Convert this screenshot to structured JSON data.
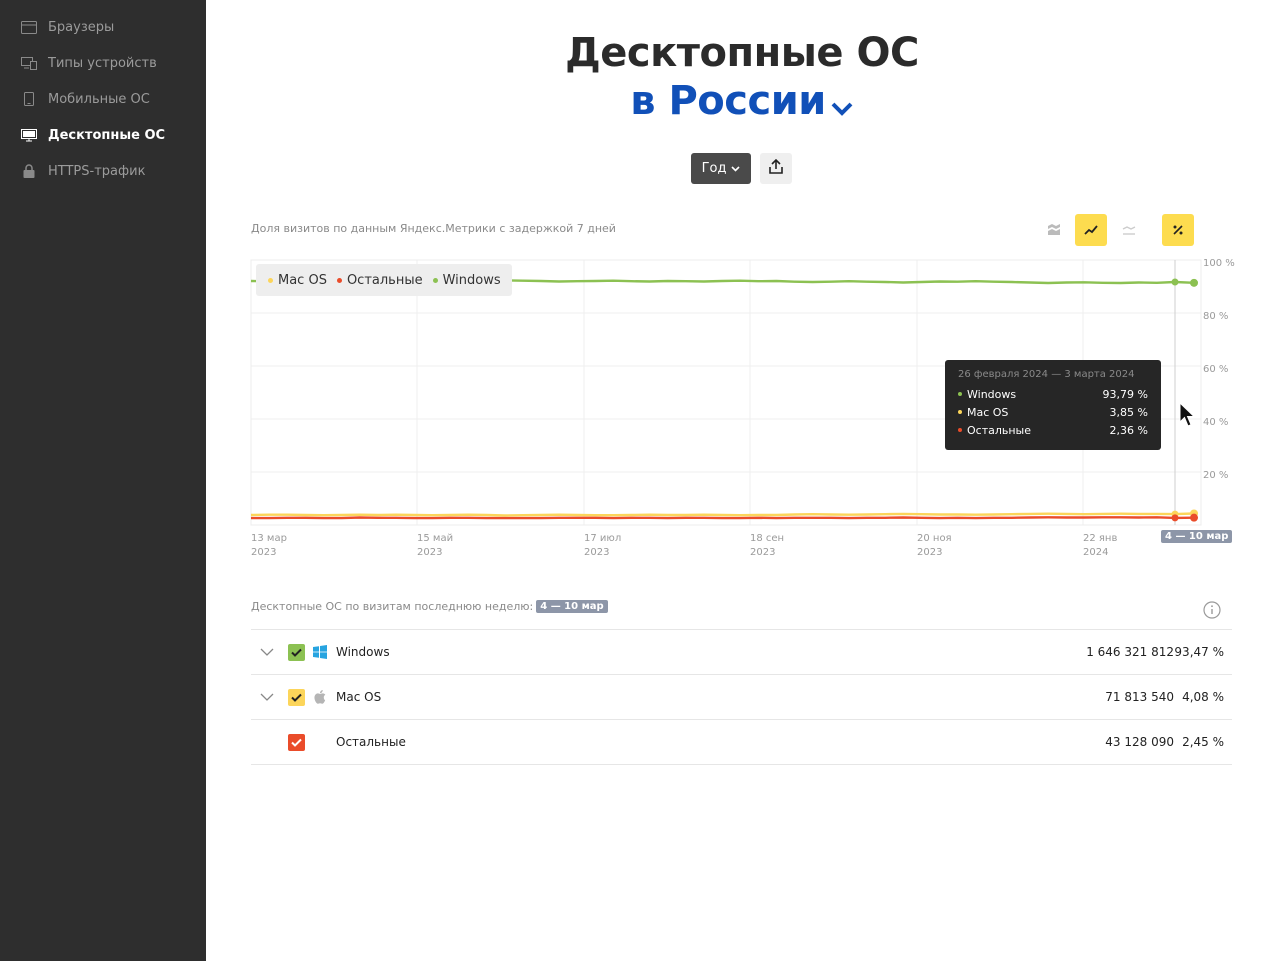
{
  "sidebar": {
    "items": [
      {
        "label": "Браузеры",
        "icon": "browser-window-icon",
        "active": false
      },
      {
        "label": "Типы устройств",
        "icon": "devices-icon",
        "active": false
      },
      {
        "label": "Мобильные ОС",
        "icon": "mobile-phone-icon",
        "active": false
      },
      {
        "label": "Десктопные ОС",
        "icon": "desktop-monitor-icon",
        "active": true
      },
      {
        "label": "HTTPS-трафик",
        "icon": "lock-icon",
        "active": false
      }
    ]
  },
  "header": {
    "title_line1": "Десктопные ОС",
    "title_line2": "в России"
  },
  "controls": {
    "period_label": "Год"
  },
  "chart": {
    "subtitle": "Доля визитов по данным Яндекс.Метрики с задержкой 7 дней",
    "current_week_label": "4 — 10 мар"
  },
  "tooltip": {
    "period": "26 февраля 2024 — 3 марта 2024",
    "rows": [
      {
        "name": "Windows",
        "value": "93,79 %",
        "color": "#8cc152"
      },
      {
        "name": "Mac OS",
        "value": "3,85 %",
        "color": "#fcd55a"
      },
      {
        "name": "Остальные",
        "value": "2,36 %",
        "color": "#ea4c2a"
      }
    ]
  },
  "chart_data": {
    "type": "line",
    "x": [
      "13 мар 2023",
      "15 май 2023",
      "17 июл 2023",
      "18 сен 2023",
      "20 ноя 2023",
      "22 янв 2024",
      "4 — 10 мар"
    ],
    "x_ticks": [
      {
        "day": "13 мар",
        "year": "2023"
      },
      {
        "day": "15 май",
        "year": "2023"
      },
      {
        "day": "17 июл",
        "year": "2023"
      },
      {
        "day": "18 сен",
        "year": "2023"
      },
      {
        "day": "20 ноя",
        "year": "2023"
      },
      {
        "day": "22 янв",
        "year": "2024"
      }
    ],
    "y_ticks": [
      "100 %",
      "80 %",
      "60 %",
      "40 %",
      "20 %"
    ],
    "ylim": [
      0,
      100
    ],
    "series": [
      {
        "name": "Windows",
        "color": "#8cc152",
        "values": [
          94.2,
          94.1,
          94.0,
          94.1,
          94.3,
          94.2,
          93.9,
          94.1,
          94.0,
          94.2,
          94.3,
          94.1,
          94.0,
          94.2,
          94.4,
          94.3,
          94.2,
          94.0,
          94.1,
          94.2,
          94.3,
          94.1,
          94.0,
          94.2,
          94.1,
          94.0,
          94.2,
          94.3,
          94.1,
          94.2,
          93.9,
          93.8,
          93.9,
          94.1,
          93.9,
          93.8,
          93.6,
          93.8,
          94.0,
          93.9,
          94.1,
          93.9,
          93.8,
          93.6,
          93.4,
          93.6,
          93.7,
          93.5,
          93.4,
          93.6,
          93.5,
          93.79,
          93.47
        ]
      },
      {
        "name": "Mac OS",
        "color": "#fcd55a",
        "values": [
          3.5,
          3.6,
          3.6,
          3.5,
          3.4,
          3.5,
          3.6,
          3.5,
          3.6,
          3.5,
          3.4,
          3.5,
          3.6,
          3.5,
          3.3,
          3.4,
          3.5,
          3.6,
          3.5,
          3.4,
          3.4,
          3.5,
          3.6,
          3.5,
          3.5,
          3.6,
          3.5,
          3.4,
          3.5,
          3.5,
          3.7,
          3.8,
          3.7,
          3.6,
          3.7,
          3.8,
          3.9,
          3.8,
          3.7,
          3.7,
          3.6,
          3.7,
          3.8,
          3.9,
          4.0,
          3.9,
          3.8,
          3.9,
          4.0,
          3.9,
          3.9,
          3.85,
          4.08
        ]
      },
      {
        "name": "Остальные",
        "color": "#ea4c2a",
        "values": [
          2.3,
          2.3,
          2.4,
          2.4,
          2.3,
          2.3,
          2.5,
          2.4,
          2.4,
          2.3,
          2.3,
          2.4,
          2.4,
          2.3,
          2.3,
          2.3,
          2.3,
          2.4,
          2.4,
          2.4,
          2.3,
          2.4,
          2.4,
          2.3,
          2.4,
          2.4,
          2.3,
          2.3,
          2.4,
          2.3,
          2.4,
          2.4,
          2.4,
          2.3,
          2.4,
          2.4,
          2.5,
          2.4,
          2.3,
          2.4,
          2.3,
          2.4,
          2.4,
          2.5,
          2.6,
          2.5,
          2.5,
          2.6,
          2.6,
          2.5,
          2.6,
          2.36,
          2.45
        ]
      }
    ],
    "grid": true,
    "legend": "top-left"
  },
  "table": {
    "title": "Десктопные ОС по визитам последнюю неделю:",
    "week": "4 — 10 мар",
    "rows": [
      {
        "name": "Windows",
        "visits": "1 646 321 812",
        "share": "93,47 %",
        "color": "#8cc152",
        "expandable": true,
        "icon": "windows-logo-icon"
      },
      {
        "name": "Mac OS",
        "visits": "71 813 540",
        "share": "4,08 %",
        "color": "#fcd55a",
        "expandable": true,
        "icon": "apple-logo-icon"
      },
      {
        "name": "Остальные",
        "visits": "43 128 090",
        "share": "2,45 %",
        "color": "#ea4c2a",
        "expandable": false,
        "icon": ""
      }
    ]
  }
}
